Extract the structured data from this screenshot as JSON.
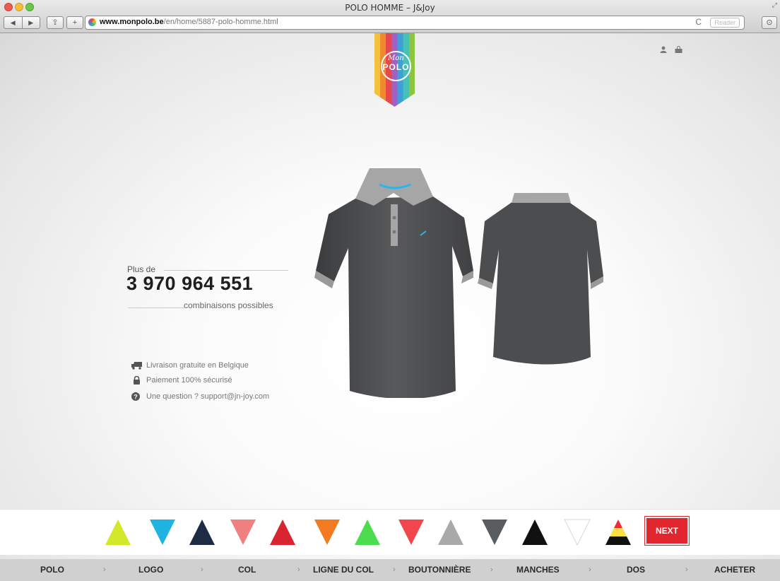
{
  "window": {
    "title": "POLO HOMME – J&Joy"
  },
  "browser": {
    "url_domain": "www.monpolo.be",
    "url_path": "/en/home/5887-polo-homme.html",
    "reader_label": "Reader",
    "back_glyph": "◀",
    "forward_glyph": "▶",
    "share_glyph": "⇪",
    "add_glyph": "+",
    "reload_glyph": "C",
    "download_glyph": "⊙",
    "fullscreen_glyph": "⤢"
  },
  "header": {
    "logo_mon": "Mon",
    "logo_polo": "POLO",
    "icons": [
      "user-icon",
      "shopping-bag-icon"
    ]
  },
  "hero": {
    "plus_de": "Plus de",
    "count": "3 970 964 551",
    "combinations": "combinaisons possibles"
  },
  "info": [
    {
      "icon": "truck-icon",
      "text": "Livraison gratuite en Belgique"
    },
    {
      "icon": "lock-icon",
      "text": "Paiement 100% sécurisé"
    },
    {
      "icon": "question-icon",
      "text": "Une question ? support@jn-joy.com"
    }
  ],
  "swatches": [
    {
      "color": "#d4e82a",
      "direction": "up"
    },
    {
      "color": "#1fb3e1",
      "direction": "down"
    },
    {
      "color": "#1f2b44",
      "direction": "up"
    },
    {
      "color": "#f08080",
      "direction": "down"
    },
    {
      "color": "#d9252f",
      "direction": "up"
    },
    {
      "color": "#f47a1f",
      "direction": "down"
    },
    {
      "color": "#4ddc4d",
      "direction": "up"
    },
    {
      "color": "#f1474c",
      "direction": "down"
    },
    {
      "color": "#a9a9a9",
      "direction": "up"
    },
    {
      "color": "#5a5d60",
      "direction": "down"
    },
    {
      "color": "#111111",
      "direction": "up"
    },
    {
      "color": "#ffffff",
      "direction": "down"
    },
    {
      "color": "tricolor-be",
      "direction": "up"
    }
  ],
  "next_label": "NEXT",
  "steps": [
    "POLO",
    "LOGO",
    "COL",
    "LIGNE DU COL",
    "BOUTONNIÈRE",
    "MANCHES",
    "DOS",
    "ACHETER"
  ],
  "separator": "›",
  "colors": {
    "accent": "#e2262e",
    "collar_stripe": "#29b6e8",
    "polo_body": "#4c4d4f",
    "collar": "#a6a6a6"
  }
}
